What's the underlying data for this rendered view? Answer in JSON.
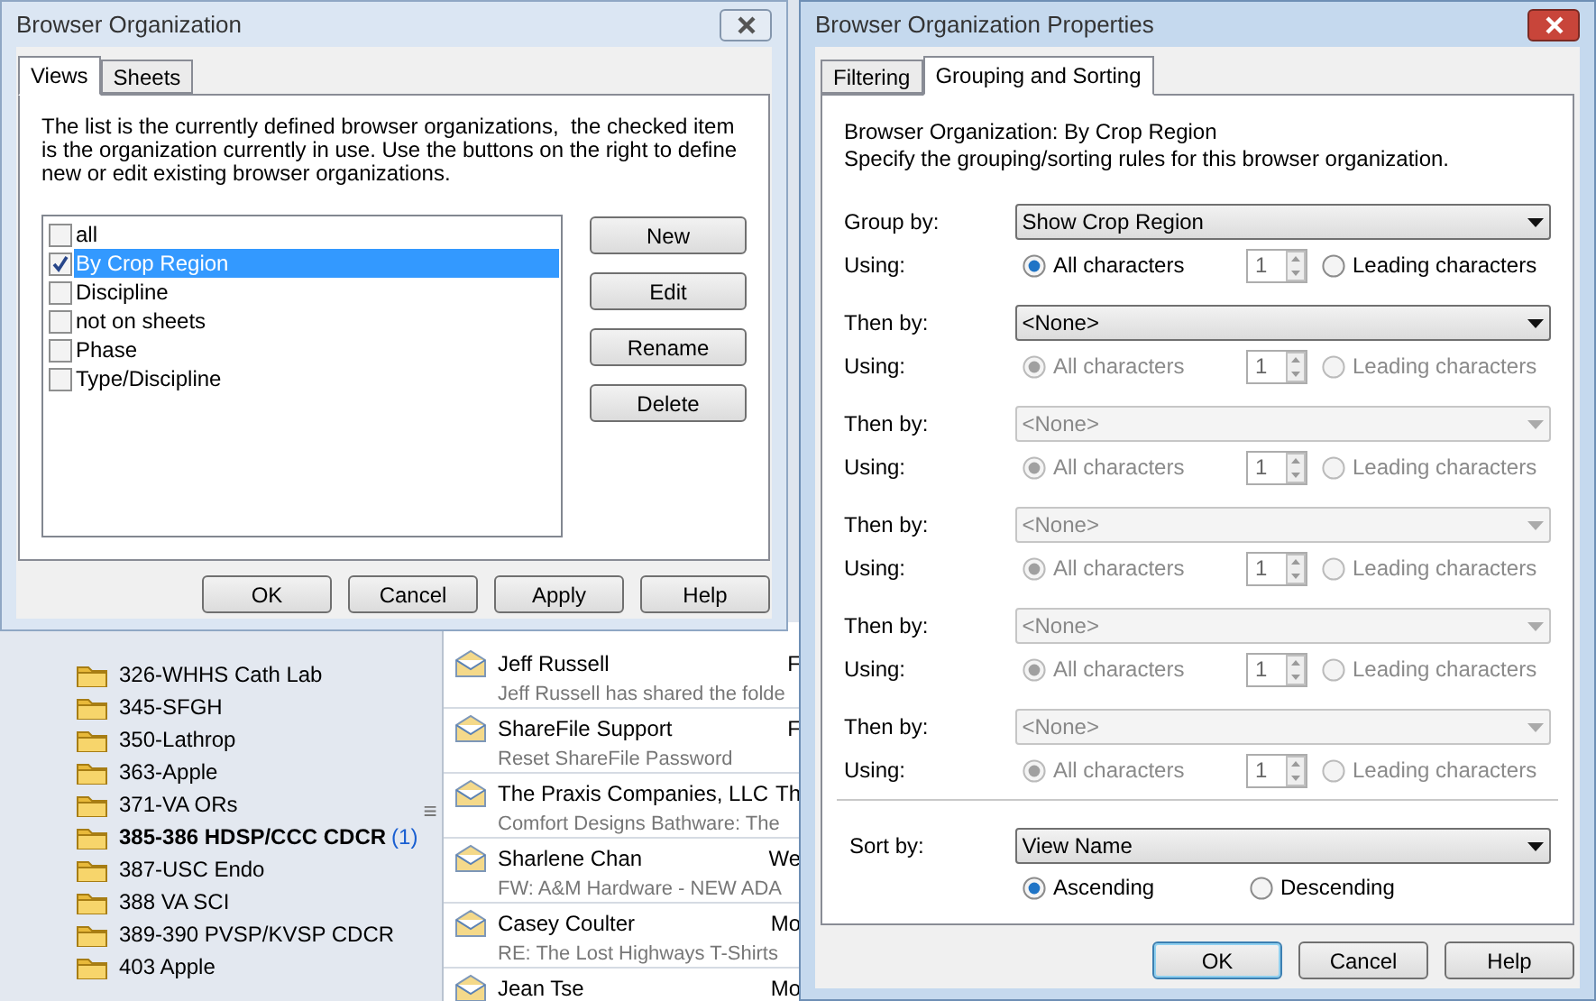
{
  "background_app": {
    "folders": [
      {
        "name": "326-WHHS Cath Lab",
        "unread": false
      },
      {
        "name": "345-SFGH",
        "unread": false
      },
      {
        "name": "350-Lathrop",
        "unread": false
      },
      {
        "name": "363-Apple",
        "unread": false
      },
      {
        "name": "371-VA ORs",
        "unread": false
      },
      {
        "name": "385-386 HDSP/CCC CDCR",
        "unread": true,
        "count": "(1)"
      },
      {
        "name": "387-USC Endo",
        "unread": false
      },
      {
        "name": "388 VA SCI",
        "unread": false
      },
      {
        "name": "389-390 PVSP/KVSP CDCR",
        "unread": false
      },
      {
        "name": "403 Apple",
        "unread": false
      }
    ],
    "splitter": "≡",
    "messages": [
      {
        "sender": "Jeff Russell",
        "column_2": "F",
        "preview": "Jeff Russell has shared the folde"
      },
      {
        "sender": "ShareFile Support",
        "column_2": "F",
        "preview": "Reset ShareFile Password"
      },
      {
        "sender": "The Praxis Companies, LLC",
        "column_2": "Th",
        "preview": "Comfort Designs Bathware: The"
      },
      {
        "sender": "Sharlene Chan",
        "column_2": "We",
        "preview": "FW: A&M Hardware - NEW ADA"
      },
      {
        "sender": "Casey Coulter",
        "column_2": "Mo",
        "preview": "RE: The Lost Highways T-Shirts"
      },
      {
        "sender": "Jean Tse",
        "column_2": "Mo"
      }
    ]
  },
  "browser_organization": {
    "title": "Browser Organization",
    "tabs": [
      {
        "label": "Views",
        "selected": true
      },
      {
        "label": "Sheets",
        "selected": false
      }
    ],
    "description": "The list is the currently defined browser organizations,  the checked item is the organization currently in use. Use the buttons on the right to define new or edit existing browser organizations.",
    "items": [
      {
        "label": "all",
        "checked": false,
        "selected": false
      },
      {
        "label": "By Crop Region",
        "checked": true,
        "selected": true
      },
      {
        "label": "Discipline",
        "checked": false,
        "selected": false
      },
      {
        "label": "not on sheets",
        "checked": false,
        "selected": false
      },
      {
        "label": "Phase",
        "checked": false,
        "selected": false
      },
      {
        "label": "Type/Discipline",
        "checked": false,
        "selected": false
      }
    ],
    "side_buttons": [
      "New",
      "Edit",
      "Rename",
      "Delete"
    ],
    "buttons": [
      "OK",
      "Cancel",
      "Apply",
      "Help"
    ]
  },
  "properties": {
    "title": "Browser Organization Properties",
    "tabs": [
      {
        "label": "Filtering",
        "selected": false
      },
      {
        "label": "Grouping and Sorting",
        "selected": true
      }
    ],
    "header": "Browser Organization: By Crop Region",
    "instructions": "Specify the grouping/sorting rules for this browser organization.",
    "rules": [
      {
        "label": "Group by:",
        "value": "Show Crop Region",
        "dropdown_disabled": false,
        "using_label": "Using:",
        "all_label": "All characters",
        "all_selected": true,
        "count": "1",
        "leading_label": "Leading characters",
        "leading_selected": false,
        "options_disabled": false
      },
      {
        "label": "Then by:",
        "value": "<None>",
        "dropdown_disabled": false,
        "using_label": "Using:",
        "all_label": "All characters",
        "all_selected": true,
        "count": "1",
        "leading_label": "Leading characters",
        "leading_selected": false,
        "options_disabled": true
      },
      {
        "label": "Then by:",
        "value": "<None>",
        "dropdown_disabled": true,
        "using_label": "Using:",
        "all_label": "All characters",
        "all_selected": true,
        "count": "1",
        "leading_label": "Leading characters",
        "leading_selected": false,
        "options_disabled": true
      },
      {
        "label": "Then by:",
        "value": "<None>",
        "dropdown_disabled": true,
        "using_label": "Using:",
        "all_label": "All characters",
        "all_selected": true,
        "count": "1",
        "leading_label": "Leading characters",
        "leading_selected": false,
        "options_disabled": true
      },
      {
        "label": "Then by:",
        "value": "<None>",
        "dropdown_disabled": true,
        "using_label": "Using:",
        "all_label": "All characters",
        "all_selected": true,
        "count": "1",
        "leading_label": "Leading characters",
        "leading_selected": false,
        "options_disabled": true
      },
      {
        "label": "Then by:",
        "value": "<None>",
        "dropdown_disabled": true,
        "using_label": "Using:",
        "all_label": "All characters",
        "all_selected": true,
        "count": "1",
        "leading_label": "Leading characters",
        "leading_selected": false,
        "options_disabled": true
      }
    ],
    "sort": {
      "label": "Sort by:",
      "value": "View Name",
      "options": [
        {
          "label": "Ascending",
          "selected": true
        },
        {
          "label": "Descending",
          "selected": false
        }
      ]
    },
    "buttons": [
      {
        "label": "OK",
        "default": true
      },
      {
        "label": "Cancel",
        "default": false
      },
      {
        "label": "Help",
        "default": false
      }
    ]
  }
}
